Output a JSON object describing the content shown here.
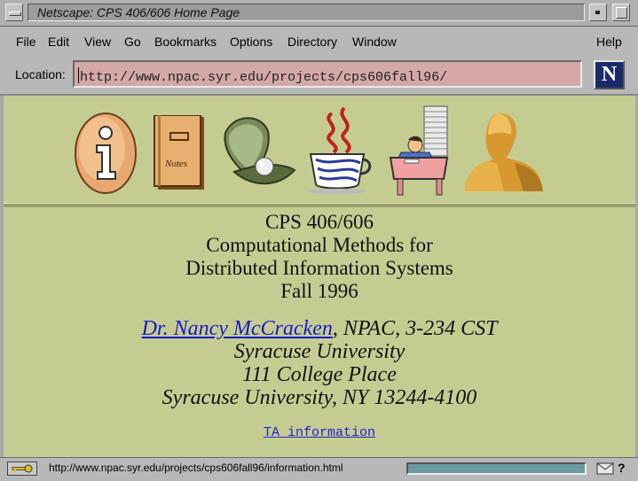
{
  "window": {
    "title": "Netscape: CPS 406/606 Home Page"
  },
  "menu": {
    "items": [
      "File",
      "Edit",
      "View",
      "Go",
      "Bookmarks",
      "Options",
      "Directory",
      "Window"
    ],
    "help": "Help"
  },
  "location": {
    "label": "Location:",
    "url": "http://www.npac.syr.edu/projects/cps606fall96/"
  },
  "logo": {
    "letter": "N"
  },
  "icons": [
    "info-icon",
    "notes-icon",
    "pearl-shell-icon",
    "java-coffee-icon",
    "paperwork-desk-icon",
    "teacher-silhouette-icon"
  ],
  "icon_labels": {
    "notes": "Notes"
  },
  "page": {
    "heading_lines": [
      "CPS 406/606",
      "Computational Methods for",
      "Distributed Information Systems",
      "Fall 1996"
    ],
    "instructor_link": "Dr. Nancy McCracken",
    "instructor_rest": ", NPAC, 3-234 CST",
    "address_lines": [
      "Syracuse University",
      "111 College Place",
      "Syracuse University, NY 13244-4100"
    ],
    "ta_link": "TA information"
  },
  "status": {
    "text": "http://www.npac.syr.edu/projects/cps606fall96/information.html",
    "progress": 1.0,
    "help_glyph": "?"
  },
  "colors": {
    "content_bg": "#c5cc92",
    "location_bg": "#d4a8a8",
    "link": "#1a1ac8",
    "chrome": "#b8b8b8"
  }
}
